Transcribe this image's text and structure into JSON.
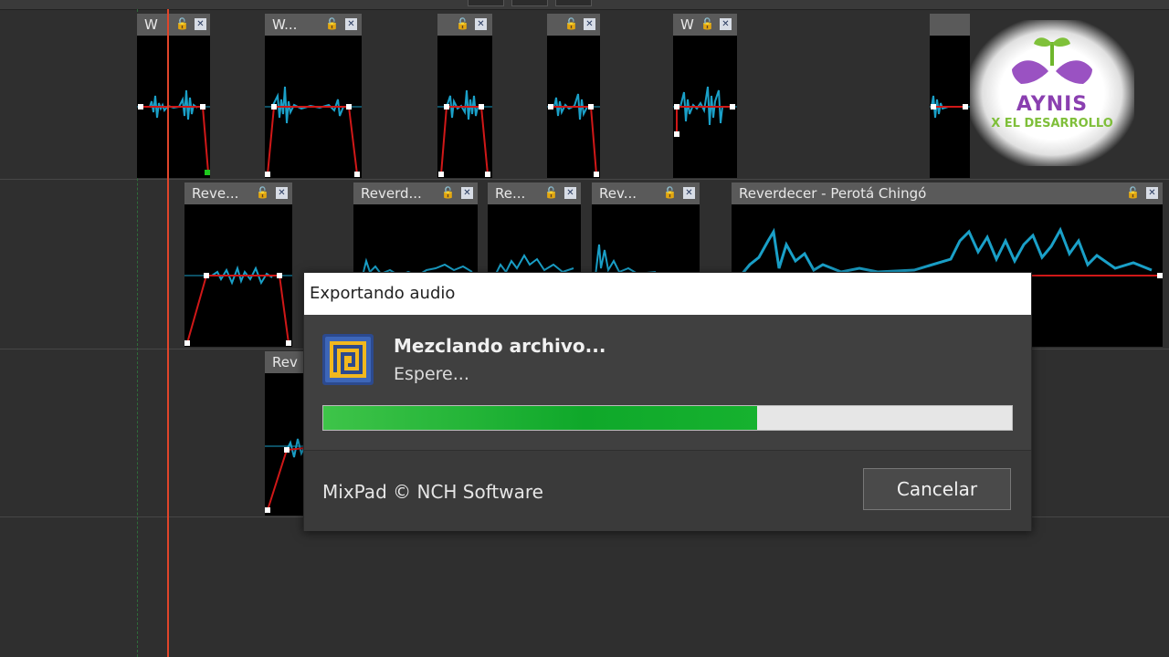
{
  "clips": {
    "c1": {
      "title": "W"
    },
    "c2": {
      "title": "W..."
    },
    "c5": {
      "title": "W"
    },
    "r1": {
      "title": "Reve..."
    },
    "r2": {
      "title": "Reverd..."
    },
    "r3": {
      "title": "Re..."
    },
    "r4": {
      "title": "Rev..."
    },
    "r5": {
      "title": "Reverdecer - Perotá Chingó"
    },
    "t1": {
      "title": "Rev"
    }
  },
  "icons": {
    "lock": "🔓",
    "close": "✕"
  },
  "watermark": {
    "line1": "AYNIS",
    "line2": "X EL DESARROLLO"
  },
  "dialog": {
    "title": "Exportando audio",
    "main_text": "Mezclando archivo...",
    "sub_text": "Espere...",
    "progress": 0.63,
    "brand": "MixPad © NCH Software",
    "cancel_label": "Cancelar"
  },
  "colors": {
    "playhead": "#e0452a",
    "waveform": "#1aa0c8",
    "envelope": "#d01818",
    "progress": "#0fa82a"
  }
}
